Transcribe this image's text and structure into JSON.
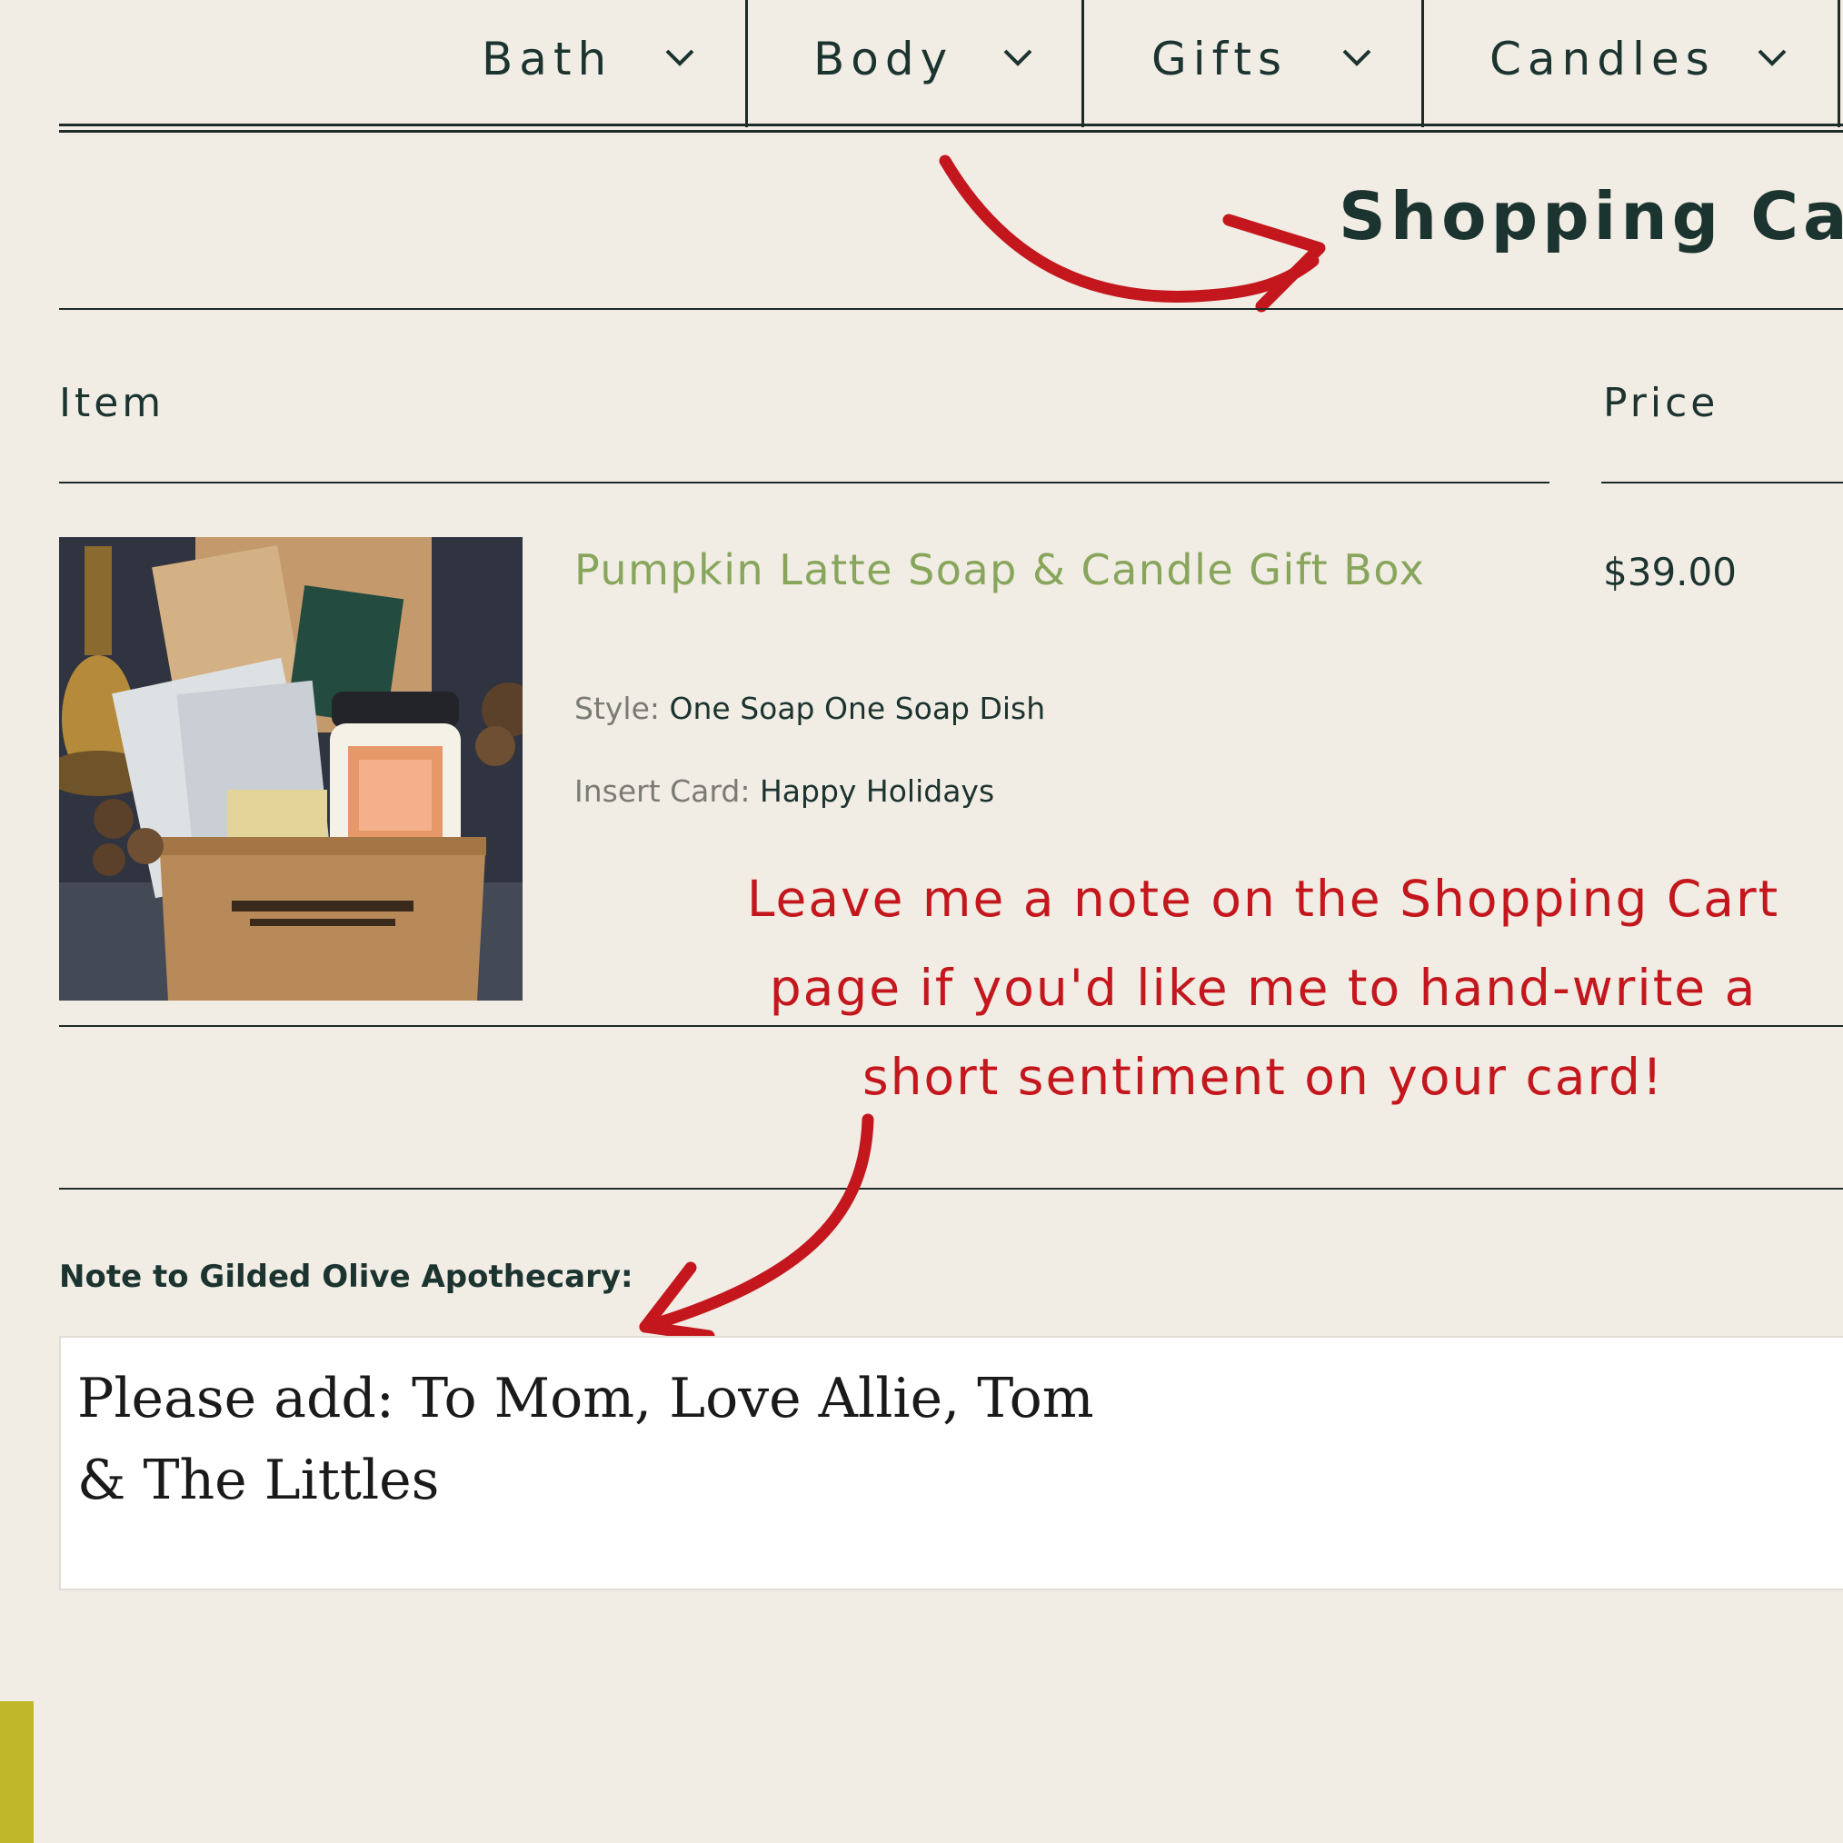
{
  "nav": {
    "items": [
      {
        "label": "Bath"
      },
      {
        "label": "Body"
      },
      {
        "label": "Gifts"
      },
      {
        "label": "Candles"
      }
    ]
  },
  "page": {
    "title": "Shopping Cart"
  },
  "table": {
    "headers": {
      "item": "Item",
      "price": "Price"
    }
  },
  "cart": {
    "items": [
      {
        "name": "Pumpkin Latte Soap & Candle Gift Box",
        "price": "$39.00",
        "style_label": "Style:",
        "style_value": "One Soap One Soap Dish",
        "insert_label": "Insert Card:",
        "insert_value": "Happy Holidays",
        "image_icon": "product-photo"
      }
    ]
  },
  "annotation": {
    "text": "Leave me a note on the Shopping Cart page if you'd like me to hand-write a short sentiment on your card!",
    "color": "#c4171d"
  },
  "note": {
    "label": "Note to Gilded Olive Apothecary:",
    "value": "Please add: To Mom, Love Allie, Tom\n& The Littles"
  },
  "colors": {
    "background": "#f1ece4",
    "text": "#1c3430",
    "product_link": "#87a65c",
    "accent_tab": "#c1b72a"
  }
}
